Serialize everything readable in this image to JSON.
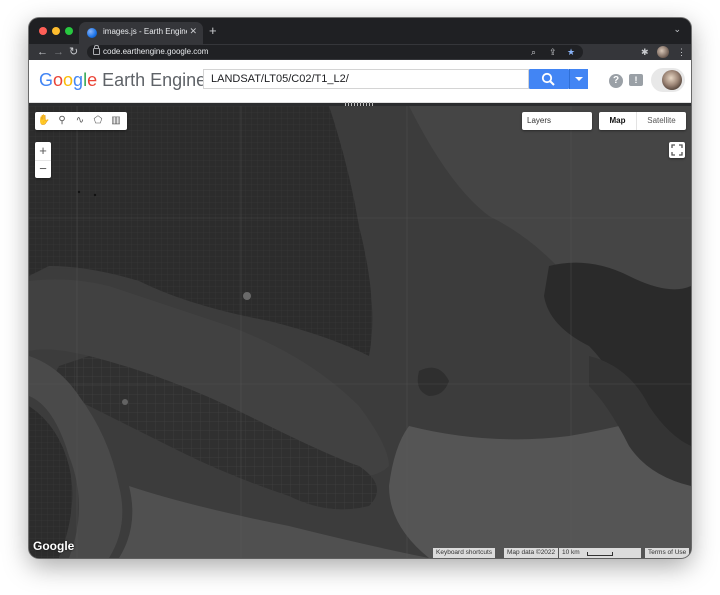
{
  "browser": {
    "tab_title": "images.js - Earth Engine Code Editor",
    "url": "code.earthengine.google.com",
    "new_tab_symbol": "+",
    "close_symbol": "✕"
  },
  "app": {
    "logo_google": "Google",
    "logo_product": "Earth Engine",
    "search_value": "LANDSAT/LT05/C02/T1_L2/",
    "help_symbol": "?",
    "feedback_symbol": "!"
  },
  "map": {
    "layers_label": "Layers",
    "maptype_map": "Map",
    "maptype_satellite": "Satellite",
    "zoom_in": "+",
    "zoom_out": "−",
    "google_watermark": "Google",
    "attribution": {
      "keyboard_shortcuts": "Keyboard shortcuts",
      "map_data": "Map data ©2022",
      "scale": "10 km",
      "terms": "Terms of Use"
    }
  },
  "colors": {
    "traffic_red": "#ff5f57",
    "traffic_yellow": "#febc2e",
    "traffic_green": "#28c840",
    "accent_blue": "#4285f4",
    "bookmark_star": "#8ab4f8"
  }
}
